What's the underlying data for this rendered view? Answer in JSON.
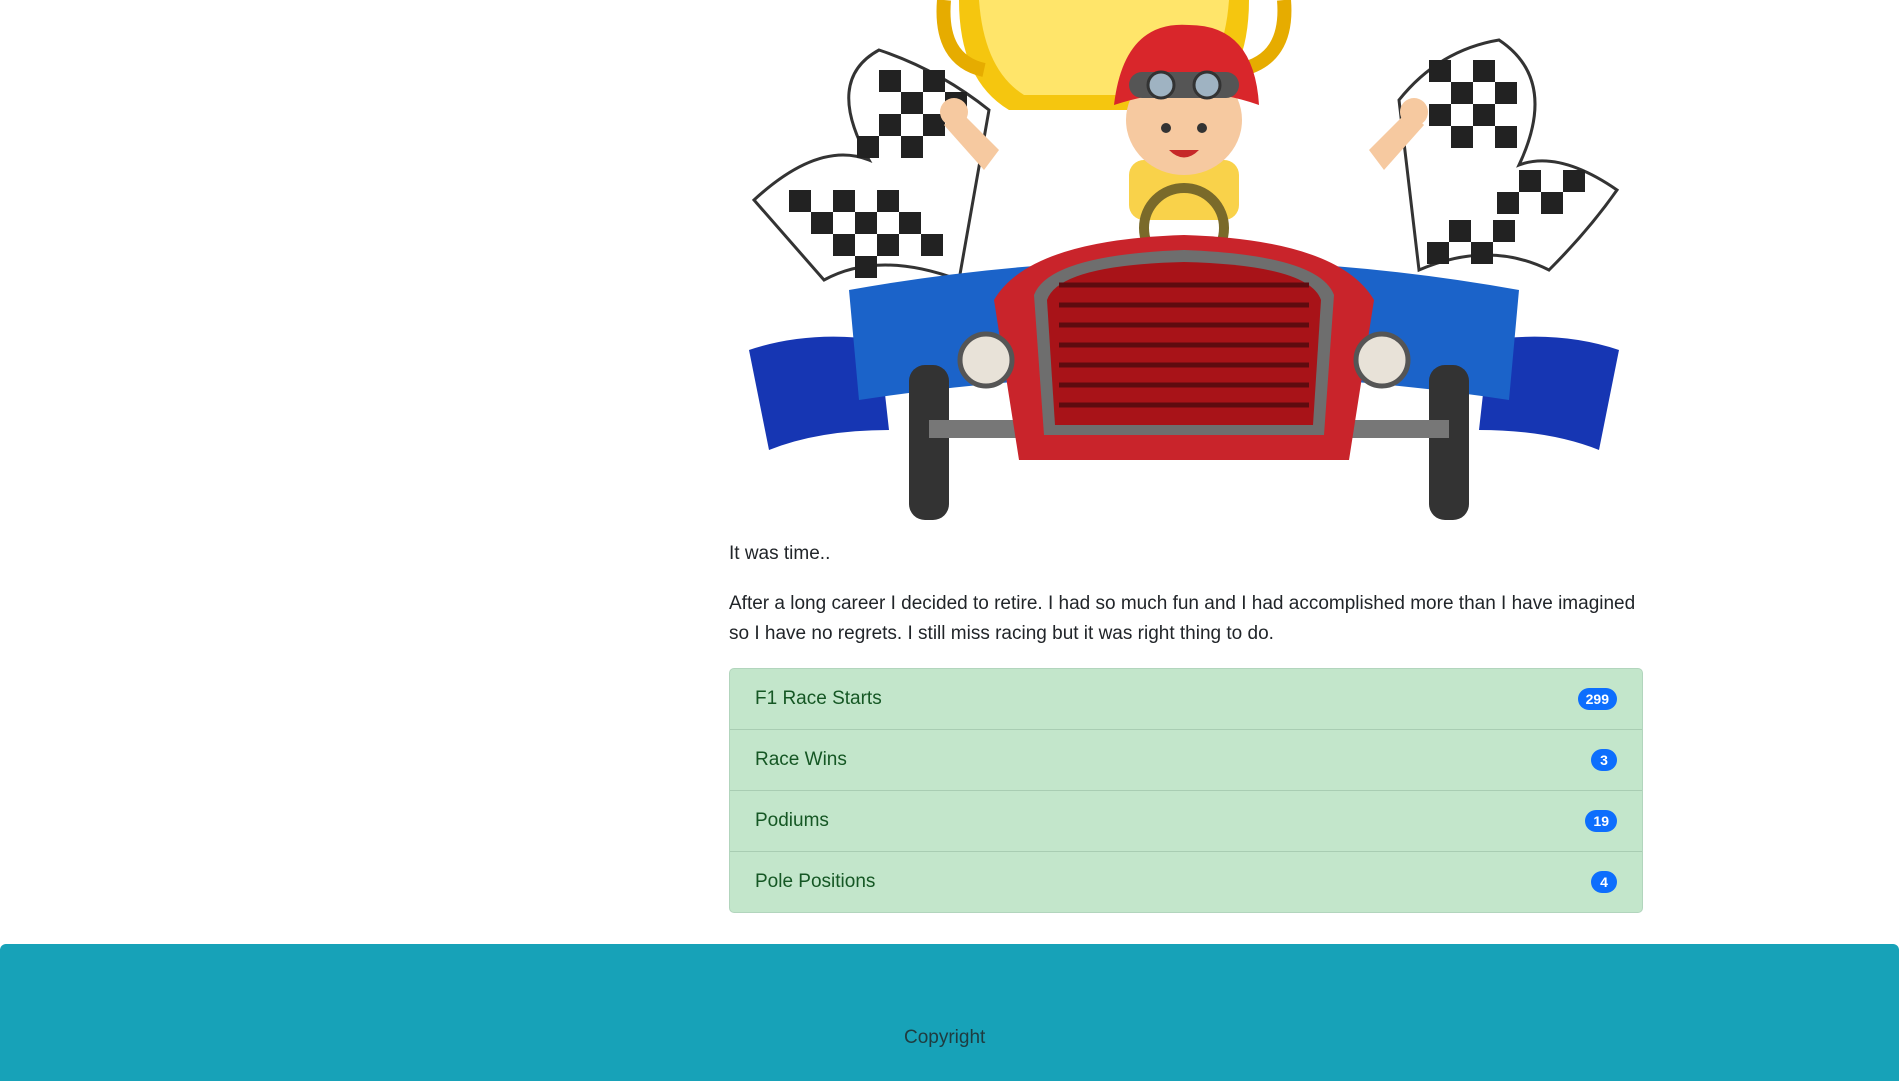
{
  "article": {
    "lead": "It was time..",
    "body": "After a long career I decided to retire. I had so much fun and I had accomplished more than I have imagined so I have no regrets. I still miss racing but it was right thing to do."
  },
  "stats": [
    {
      "label": "F1 Race Starts",
      "value": "299"
    },
    {
      "label": "Race Wins",
      "value": "3"
    },
    {
      "label": "Podiums",
      "value": "19"
    },
    {
      "label": "Pole Positions",
      "value": "4"
    }
  ],
  "footer": {
    "text": "Copyright"
  },
  "colors": {
    "list_bg": "#c3e6cb",
    "list_text": "#155724",
    "badge": "#0d6efd",
    "footer": "#17a2b8"
  }
}
